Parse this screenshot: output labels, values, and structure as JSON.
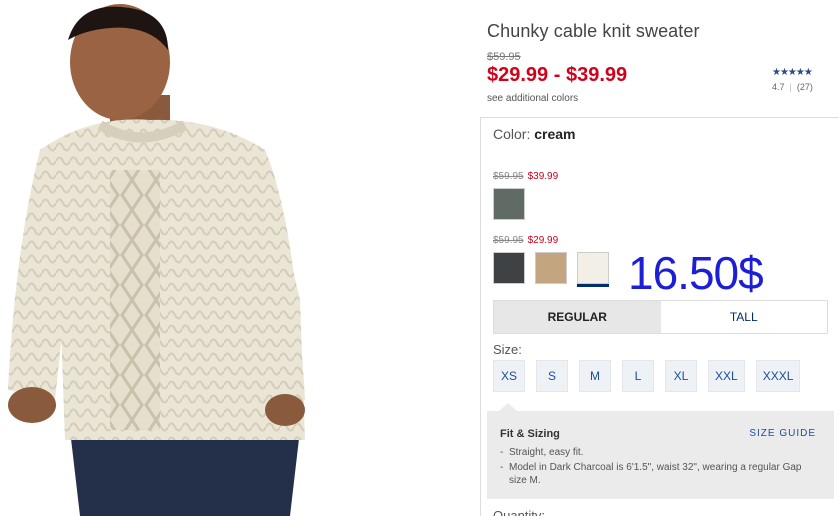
{
  "product": {
    "title": "Chunky cable knit sweater",
    "original_price": "$59.95",
    "sale_price_range": "$29.99 - $39.99",
    "see_colors": "see additional colors"
  },
  "rating": {
    "stars": "★★★★★",
    "score": "4.7",
    "count": "(27)"
  },
  "color": {
    "label": "Color:",
    "value": "cream",
    "groups": [
      {
        "original": "$59.95",
        "sale": "$39.99",
        "swatches": [
          "#5f6b64"
        ]
      },
      {
        "original": "$59.95",
        "sale": "$29.99",
        "swatches": [
          "#3e4244",
          "#c3a57f",
          "#f1efe6"
        ]
      }
    ]
  },
  "overlay_text": "16.50$",
  "fit_tabs": [
    "REGULAR",
    "TALL"
  ],
  "size": {
    "label": "Size:",
    "options": [
      "XS",
      "S",
      "M",
      "L",
      "XL",
      "XXL",
      "XXXL"
    ]
  },
  "fit_sizing": {
    "title": "Fit & Sizing",
    "size_guide": "SIZE GUIDE",
    "bullets": [
      "Straight, easy fit.",
      "Model in Dark Charcoal is 6'1.5\", waist 32\", wearing a regular Gap size M."
    ]
  },
  "quantity_label": "Quantity:",
  "colors": {
    "sale_red": "#d0021b",
    "link_blue": "#1a4e9c",
    "overlay_blue": "#1c1fd3"
  }
}
